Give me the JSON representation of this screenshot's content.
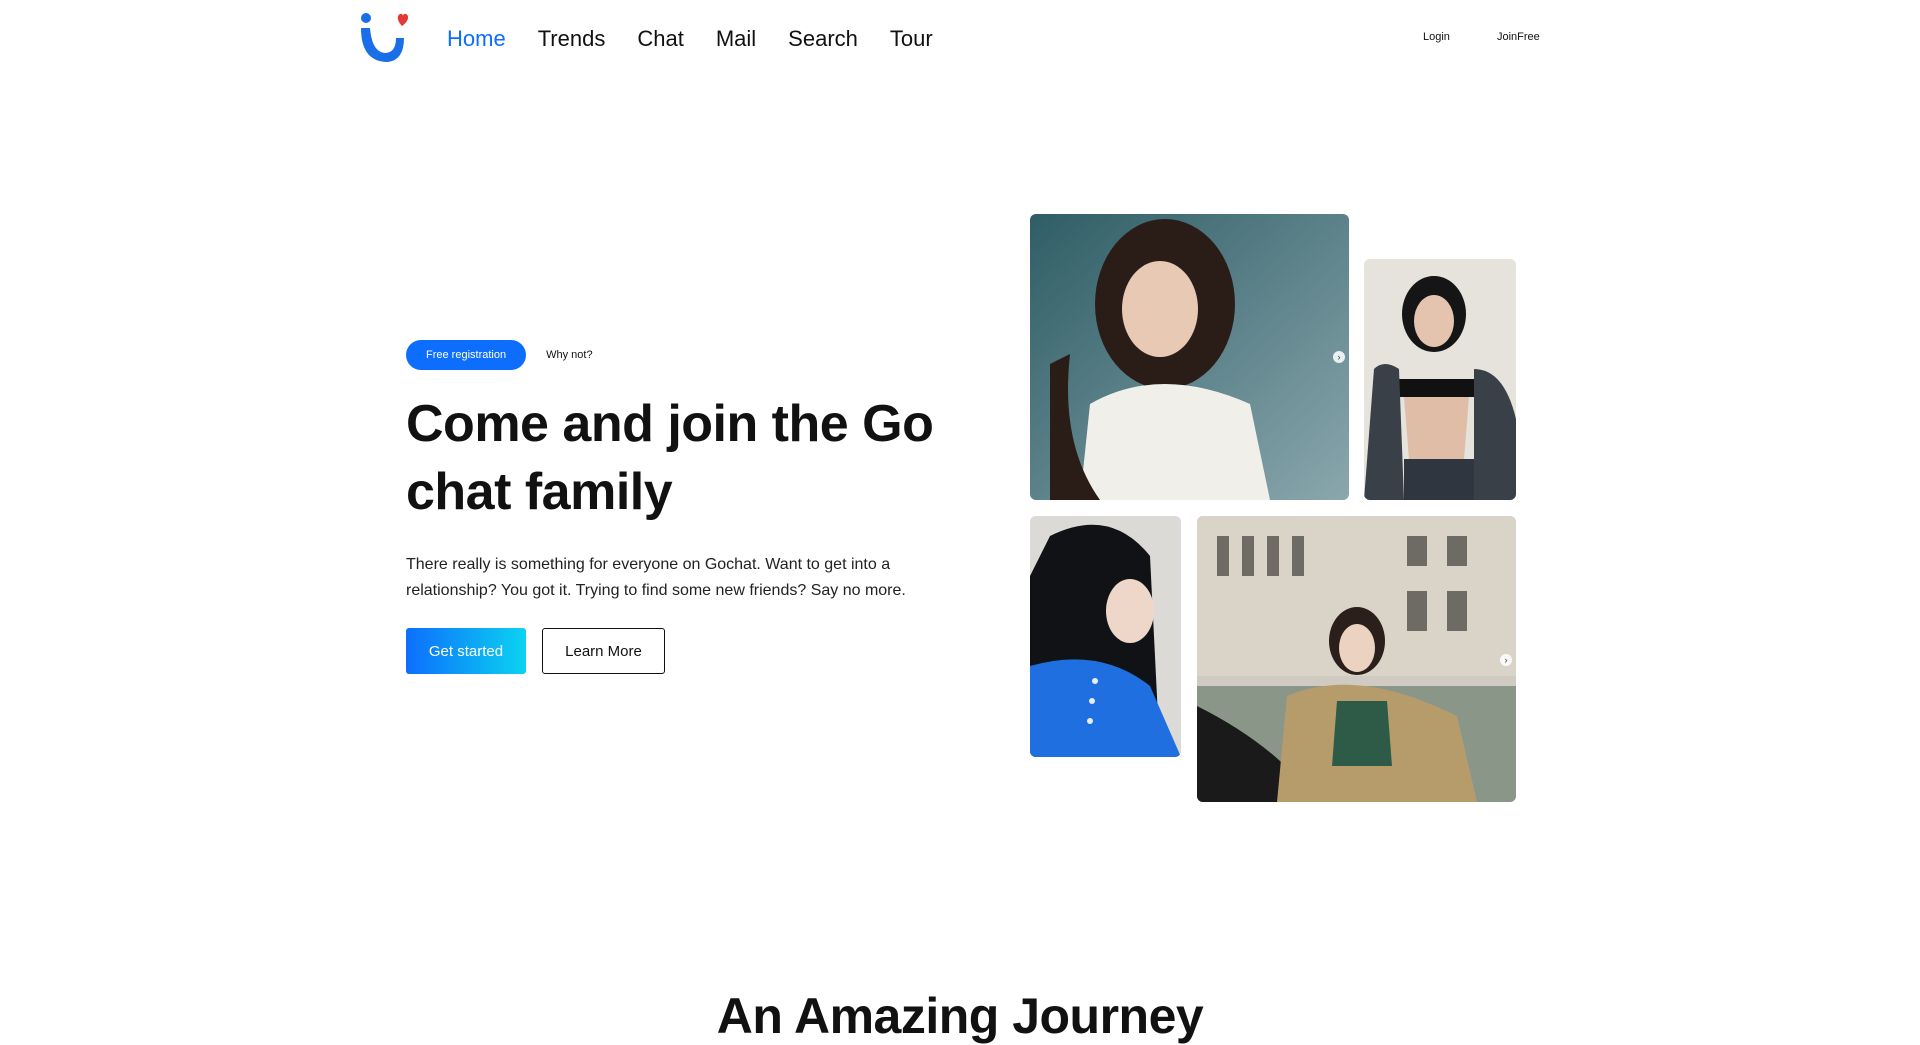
{
  "header": {
    "logo_icon": "smile-heart-logo",
    "nav": [
      {
        "label": "Home",
        "active": true
      },
      {
        "label": "Trends",
        "active": false
      },
      {
        "label": "Chat",
        "active": false
      },
      {
        "label": "Mail",
        "active": false
      },
      {
        "label": "Search",
        "active": false
      },
      {
        "label": "Tour",
        "active": false
      }
    ],
    "login_label": "Login",
    "join_label": "JoinFree"
  },
  "hero": {
    "badge_label": "Free registration",
    "badge_note": "Why not?",
    "title": "Come and join the Go chat family",
    "description": "There really is something for everyone on Gochat. Want to get into a relationship? You got it. Trying to find some new friends? Say no more.",
    "primary_button": "Get started",
    "secondary_button": "Learn More"
  },
  "gallery": {
    "photos": [
      "profile-photo-1",
      "profile-photo-2",
      "profile-photo-3",
      "profile-photo-4"
    ],
    "next_icon": "chevron-right-icon"
  },
  "section": {
    "title": "An Amazing Journey"
  },
  "colors": {
    "accent": "#0d6efd",
    "gradient_end": "#0bd3f0",
    "logo_heart": "#e53935"
  }
}
